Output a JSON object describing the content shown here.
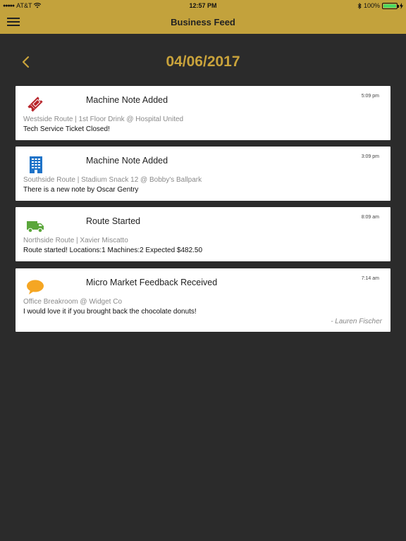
{
  "status_bar": {
    "carrier": "AT&T",
    "time": "12:57 PM",
    "battery": "100%",
    "battery_level": 1.0
  },
  "nav": {
    "title": "Business Feed"
  },
  "date_header": {
    "date": "04/06/2017"
  },
  "colors": {
    "gold": "#c3a23c",
    "date_gold": "#c9a33b",
    "bg": "#2b2b2b",
    "ticket_red": "#b8252b",
    "building_blue": "#1e73c8",
    "truck_green": "#5aa63a",
    "bubble_orange": "#f5a623"
  },
  "feed": [
    {
      "icon": "ticket-icon",
      "title": "Machine Note Added",
      "time": "5:09 pm",
      "subtitle": "Westside Route | 1st Floor Drink @ Hospital United",
      "body": "Tech Service Ticket Closed!"
    },
    {
      "icon": "building-icon",
      "title": "Machine Note Added",
      "time": "3:09 pm",
      "subtitle": "Southside Route | Stadium Snack 12 @ Bobby's Ballpark",
      "body": "There is a new note by Oscar Gentry"
    },
    {
      "icon": "truck-icon",
      "title": "Route Started",
      "time": "8:09 am",
      "subtitle": "Northside Route | Xavier Miscatto",
      "body": "Route started! Locations:1 Machines:2 Expected $482.50"
    },
    {
      "icon": "speech-bubble-icon",
      "title": "Micro Market Feedback Received",
      "time": "7:14 am",
      "subtitle": "Office Breakroom @ Widget Co",
      "body": "I would love it if you brought back the chocolate donuts!",
      "signature": "- Lauren Fischer"
    }
  ]
}
